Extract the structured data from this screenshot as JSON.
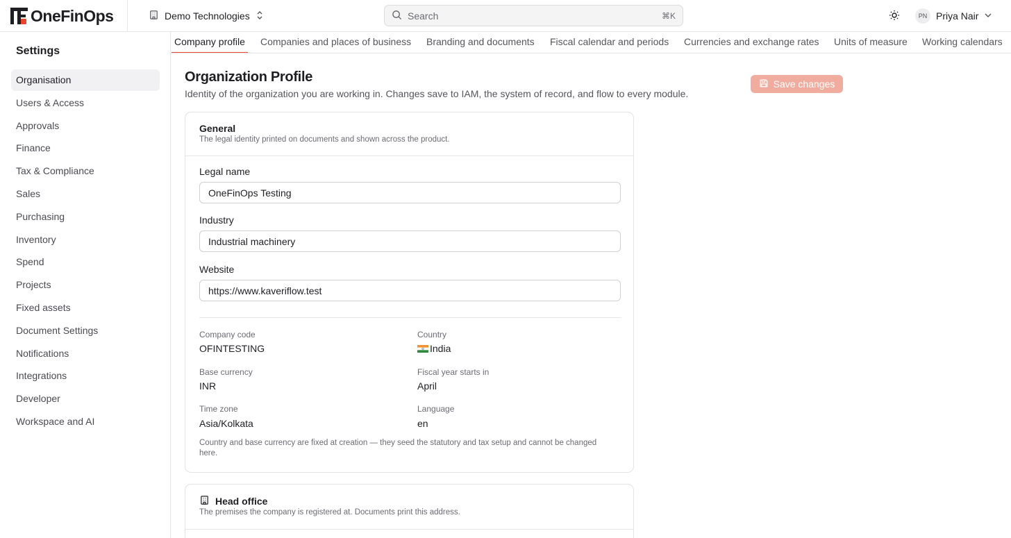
{
  "brand": {
    "name": "OneFinOps",
    "accent": "#e8472e"
  },
  "org_switcher": {
    "name": "Demo Technologies"
  },
  "search": {
    "placeholder": "Search",
    "shortcut": "⌘K"
  },
  "user": {
    "initials": "PN",
    "name": "Priya Nair"
  },
  "sidebar": {
    "title": "Settings",
    "items": [
      {
        "label": "Organisation",
        "active": true
      },
      {
        "label": "Users & Access"
      },
      {
        "label": "Approvals"
      },
      {
        "label": "Finance"
      },
      {
        "label": "Tax & Compliance"
      },
      {
        "label": "Sales"
      },
      {
        "label": "Purchasing"
      },
      {
        "label": "Inventory"
      },
      {
        "label": "Spend"
      },
      {
        "label": "Projects"
      },
      {
        "label": "Fixed assets"
      },
      {
        "label": "Document Settings"
      },
      {
        "label": "Notifications"
      },
      {
        "label": "Integrations"
      },
      {
        "label": "Developer"
      },
      {
        "label": "Workspace and AI"
      }
    ]
  },
  "tabs": [
    {
      "label": "Company profile",
      "active": true
    },
    {
      "label": "Companies and places of business"
    },
    {
      "label": "Branding and documents"
    },
    {
      "label": "Fiscal calendar and periods"
    },
    {
      "label": "Currencies and exchange rates"
    },
    {
      "label": "Units of measure"
    },
    {
      "label": "Working calendars"
    }
  ],
  "page": {
    "title": "Organization Profile",
    "subtitle": "Identity of the organization you are working in. Changes save to IAM, the system of record, and flow to every module.",
    "save_label": "Save changes"
  },
  "general": {
    "title": "General",
    "description": "The legal identity printed on documents and shown across the product.",
    "fields": {
      "legal_name": {
        "label": "Legal name",
        "value": "OneFinOps Testing"
      },
      "industry": {
        "label": "Industry",
        "value": "Industrial machinery"
      },
      "website": {
        "label": "Website",
        "value": "https://www.kaveriflow.test"
      }
    },
    "info": {
      "company_code": {
        "label": "Company code",
        "value": "OFINTESTING"
      },
      "country": {
        "label": "Country",
        "value": "India"
      },
      "base_currency": {
        "label": "Base currency",
        "value": "INR"
      },
      "fiscal_year": {
        "label": "Fiscal year starts in",
        "value": "April"
      },
      "time_zone": {
        "label": "Time zone",
        "value": "Asia/Kolkata"
      },
      "language": {
        "label": "Language",
        "value": "en"
      }
    },
    "note": "Country and base currency are fixed at creation — they seed the statutory and tax setup and cannot be changed here."
  },
  "head_office": {
    "title": "Head office",
    "description": "The premises the company is registered at. Documents print this address."
  }
}
